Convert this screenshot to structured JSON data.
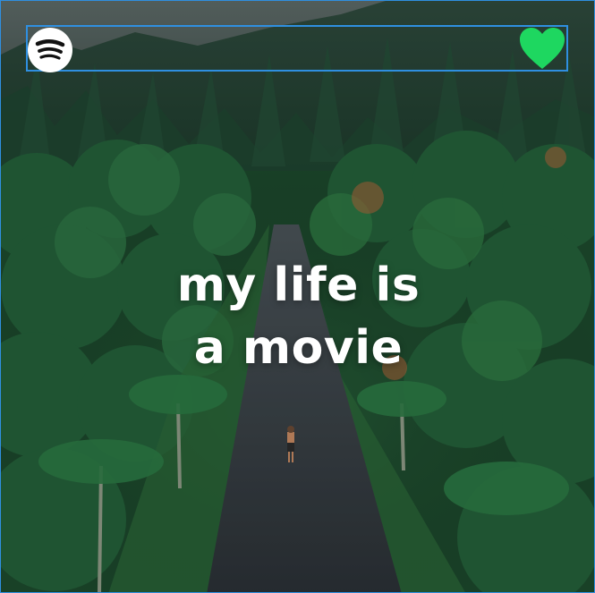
{
  "cover": {
    "title_line_1": "my life is",
    "title_line_2": "a movie"
  },
  "icons": {
    "logo": "spotify-logo-icon",
    "like": "heart-icon"
  },
  "colors": {
    "frame": "#2f8fe0",
    "heart": "#1ed760",
    "logo_bg": "#ffffff",
    "logo_fg": "#111111",
    "text": "#ffffff"
  }
}
